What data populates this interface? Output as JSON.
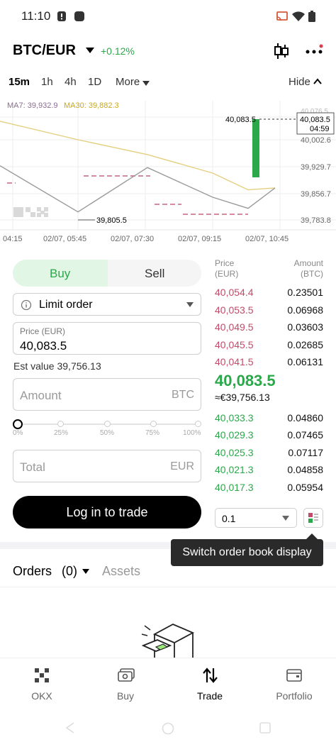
{
  "status_bar": {
    "time": "11:10"
  },
  "header": {
    "pair": "BTC/EUR",
    "change": "+0.12%"
  },
  "timeframes": {
    "items": [
      "15m",
      "1h",
      "4h",
      "1D"
    ],
    "active": "15m",
    "more": "More",
    "hide": "Hide"
  },
  "chart": {
    "ma7_label": "MA7: 39,932.9",
    "ma30_label": "MA30: 39,882.3",
    "y_ticks": [
      "40,076.5",
      "40,002.6",
      "39,929.7",
      "39,856.7",
      "39,783.8"
    ],
    "x_ticks": [
      "04:15",
      "02/07, 05:45",
      "02/07, 07:30",
      "02/07, 09:15",
      "02/07, 10:45"
    ],
    "last_price_label": "40,083.5",
    "current_price_box": "40,083.5",
    "countdown": "04:59",
    "low_label": "39,805.5",
    "colors": {
      "ma7": "#8a6d8f",
      "ma30": "#d4b21a",
      "up": "#2ba84a",
      "down": "#c44a69"
    }
  },
  "chart_data": {
    "type": "line",
    "title": "",
    "x_ticks": [
      "04:15",
      "02/07, 05:45",
      "02/07, 07:30",
      "02/07, 09:15",
      "02/07, 10:45"
    ],
    "ylim": [
      39783.8,
      40076.5
    ],
    "y_ticks": [
      40076.5,
      40002.6,
      39929.7,
      39856.7,
      39783.8
    ],
    "series": [
      {
        "name": "MA7: 39,932.9",
        "values": [
          39930,
          39805.5,
          39925,
          39845,
          39815,
          39870
        ]
      },
      {
        "name": "MA30: 39,882.3",
        "values": [
          40050,
          40000,
          39960,
          39910,
          39865,
          39870
        ]
      }
    ],
    "current_price": 40083.5,
    "low_annotation": 39805.5
  },
  "trade_form": {
    "buy_label": "Buy",
    "sell_label": "Sell",
    "order_type": "Limit order",
    "price_label": "Price (EUR)",
    "price_value": "40,083.5",
    "est_value": "Est value 39,756.13",
    "amount_placeholder": "Amount",
    "amount_unit": "BTC",
    "slider_ticks": [
      "0%",
      "25%",
      "50%",
      "75%",
      "100%"
    ],
    "slider_value_pct": 0,
    "total_placeholder": "Total",
    "total_unit": "EUR",
    "login_button": "Log in to trade"
  },
  "order_book": {
    "price_header": "Price",
    "price_header_unit": "(EUR)",
    "amount_header": "Amount",
    "amount_header_unit": "(BTC)",
    "asks": [
      {
        "price": "40,054.4",
        "amount": "0.23501"
      },
      {
        "price": "40,053.5",
        "amount": "0.06968"
      },
      {
        "price": "40,049.5",
        "amount": "0.03603"
      },
      {
        "price": "40,045.5",
        "amount": "0.02685"
      },
      {
        "price": "40,041.5",
        "amount": "0.06131"
      }
    ],
    "mid_price": "40,083.5",
    "mid_eur": "≈€39,756.13",
    "bids": [
      {
        "price": "40,033.3",
        "amount": "0.04860"
      },
      {
        "price": "40,029.3",
        "amount": "0.07465"
      },
      {
        "price": "40,025.3",
        "amount": "0.07117"
      },
      {
        "price": "40,021.3",
        "amount": "0.04858"
      },
      {
        "price": "40,017.3",
        "amount": "0.05954"
      }
    ],
    "depth_value": "0.1",
    "tooltip": "Switch order book display"
  },
  "orders": {
    "orders_label": "Orders",
    "orders_count": "(0)",
    "assets_label": "Assets"
  },
  "bottom_nav": {
    "items": [
      {
        "label": "OKX",
        "icon": "okx-logo-icon"
      },
      {
        "label": "Buy",
        "icon": "cash-icon"
      },
      {
        "label": "Trade",
        "icon": "trade-arrows-icon"
      },
      {
        "label": "Portfolio",
        "icon": "wallet-icon"
      }
    ],
    "active": "Trade"
  }
}
